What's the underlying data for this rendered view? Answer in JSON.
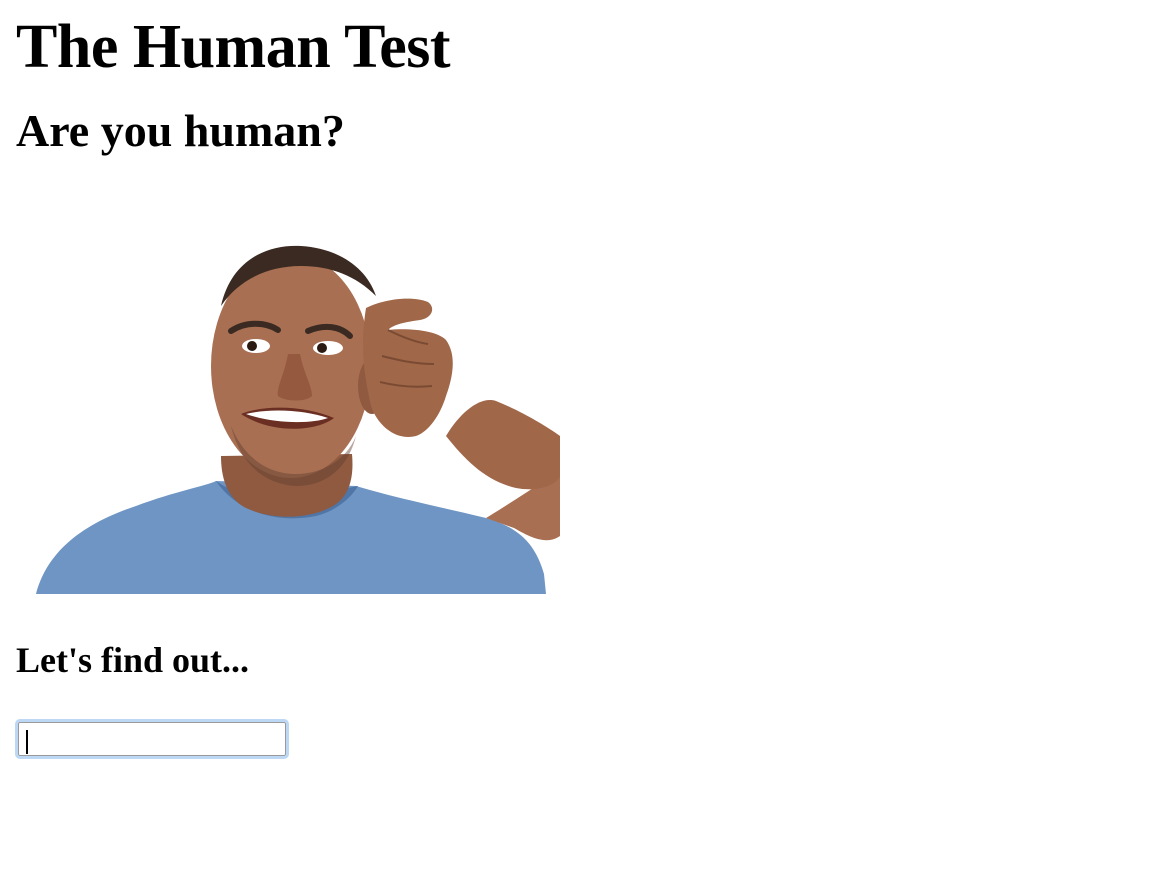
{
  "page": {
    "title": "The Human Test",
    "subtitle": "Are you human?",
    "prompt": "Let's find out...",
    "photo": {
      "icon": "confused-man-photo",
      "colors": {
        "skin": "#a86f52",
        "skin_dark": "#7a4a33",
        "shirt": "#6e95c4",
        "shirt_dark": "#4f76a6",
        "hair": "#3a2a22"
      }
    },
    "answer_input": {
      "value": "",
      "placeholder": "",
      "focus_ring_color": "#bcd8f5"
    }
  }
}
